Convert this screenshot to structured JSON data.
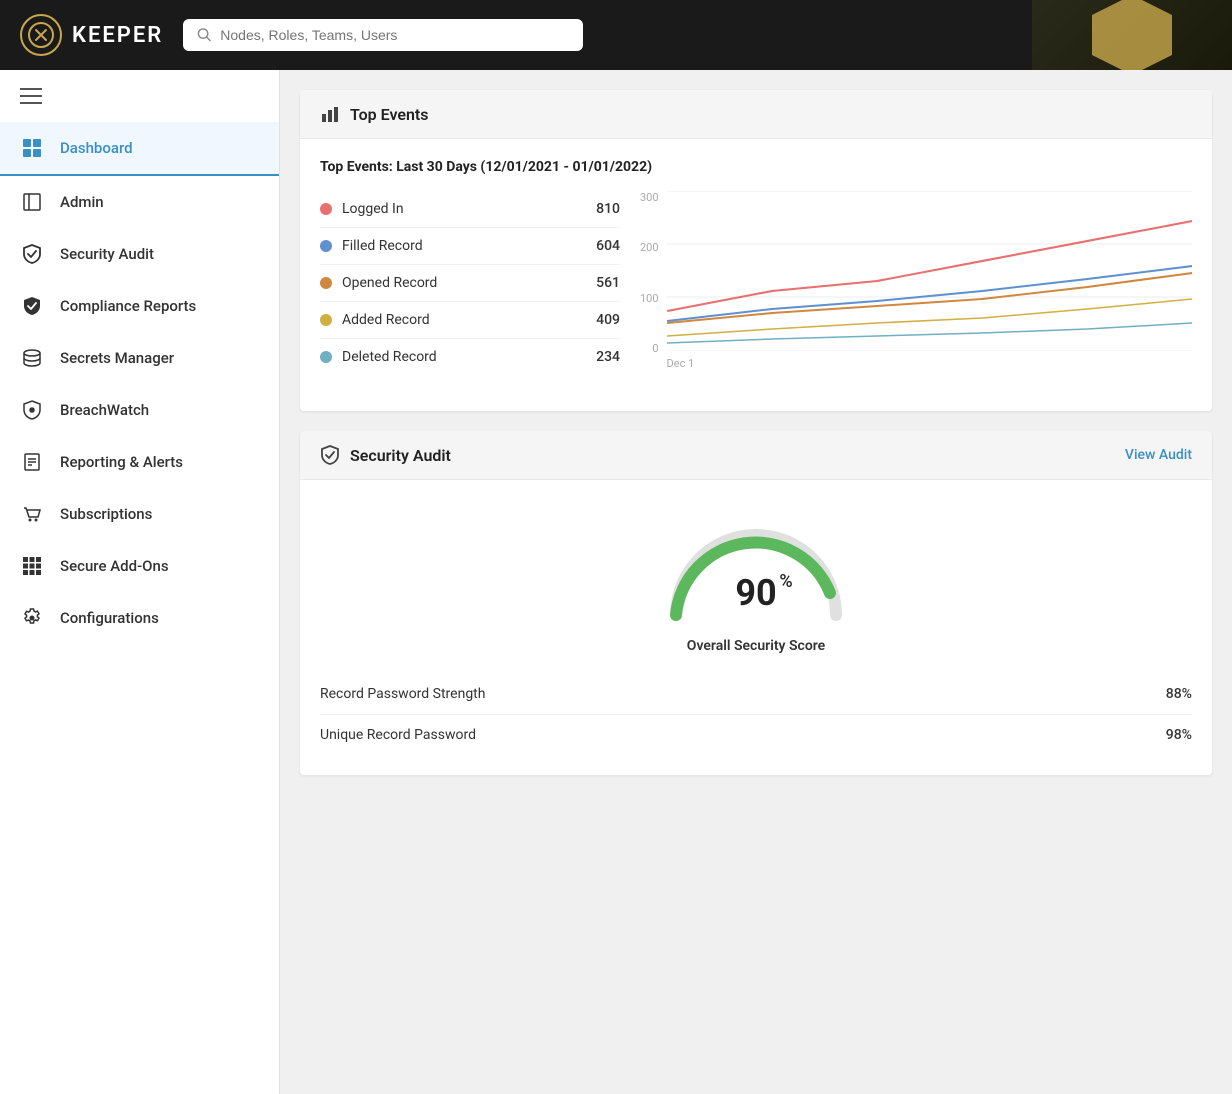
{
  "header": {
    "logo_text": "KEEPER",
    "search_placeholder": "Nodes, Roles, Teams, Users"
  },
  "sidebar": {
    "hamburger_label": "Menu",
    "items": [
      {
        "id": "dashboard",
        "label": "Dashboard",
        "icon": "grid",
        "active": true
      },
      {
        "id": "admin",
        "label": "Admin",
        "icon": "admin"
      },
      {
        "id": "security-audit",
        "label": "Security Audit",
        "icon": "shield"
      },
      {
        "id": "compliance-reports",
        "label": "Compliance Reports",
        "icon": "check-shield"
      },
      {
        "id": "secrets-manager",
        "label": "Secrets Manager",
        "icon": "layers"
      },
      {
        "id": "breachwatch",
        "label": "BreachWatch",
        "icon": "breachwatch"
      },
      {
        "id": "reporting-alerts",
        "label": "Reporting & Alerts",
        "icon": "doc"
      },
      {
        "id": "subscriptions",
        "label": "Subscriptions",
        "icon": "cart"
      },
      {
        "id": "secure-addons",
        "label": "Secure Add-Ons",
        "icon": "apps"
      },
      {
        "id": "configurations",
        "label": "Configurations",
        "icon": "gear"
      }
    ]
  },
  "top_events": {
    "section_title": "Top Events",
    "subtitle": "Top Events: Last 30 Days (12/01/2021 - 01/01/2022)",
    "events": [
      {
        "name": "Logged In",
        "count": "810",
        "color": "#e87070"
      },
      {
        "name": "Filled Record",
        "count": "604",
        "color": "#6090d0"
      },
      {
        "name": "Opened Record",
        "count": "561",
        "color": "#d08840"
      },
      {
        "name": "Added Record",
        "count": "409",
        "color": "#d0b040"
      },
      {
        "name": "Deleted Record",
        "count": "234",
        "color": "#70b0c0"
      }
    ],
    "chart": {
      "y_labels": [
        "300",
        "200",
        "100",
        "0"
      ],
      "x_label": "Dec 1"
    }
  },
  "security_audit": {
    "section_title": "Security Audit",
    "view_audit_label": "View Audit",
    "score_value": "90",
    "score_unit": "%",
    "score_label": "Overall Security Score",
    "metrics": [
      {
        "label": "Record Password Strength",
        "value": "88%"
      },
      {
        "label": "Unique Record Password",
        "value": "98%"
      }
    ]
  }
}
